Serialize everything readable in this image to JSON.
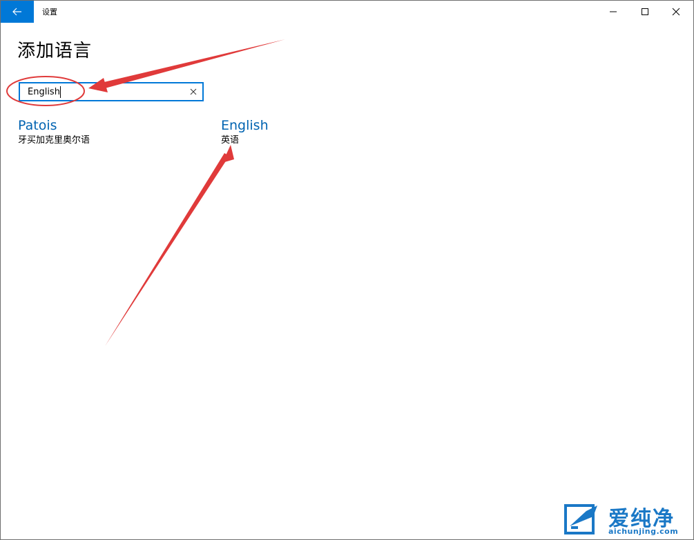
{
  "titlebar": {
    "app_title": "设置",
    "back_icon": "back-arrow-icon",
    "minimize_icon": "minimize-icon",
    "maximize_icon": "maximize-icon",
    "close_icon": "close-icon",
    "accent_color": "#0078d7"
  },
  "page": {
    "title": "添加语言"
  },
  "search": {
    "value": "English",
    "clear_icon": "clear-x-icon"
  },
  "results": [
    {
      "name": "Patois",
      "native": "牙买加克里奥尔语"
    },
    {
      "name": "English",
      "native": "英语"
    }
  ],
  "annotations": {
    "color": "#e03a3a",
    "circle_target": "search-input",
    "arrow_targets": [
      "search-input",
      "result-english"
    ]
  },
  "watermark": {
    "main": "爱纯净",
    "sub": "aichunjing.com",
    "color": "#1a78c6"
  }
}
